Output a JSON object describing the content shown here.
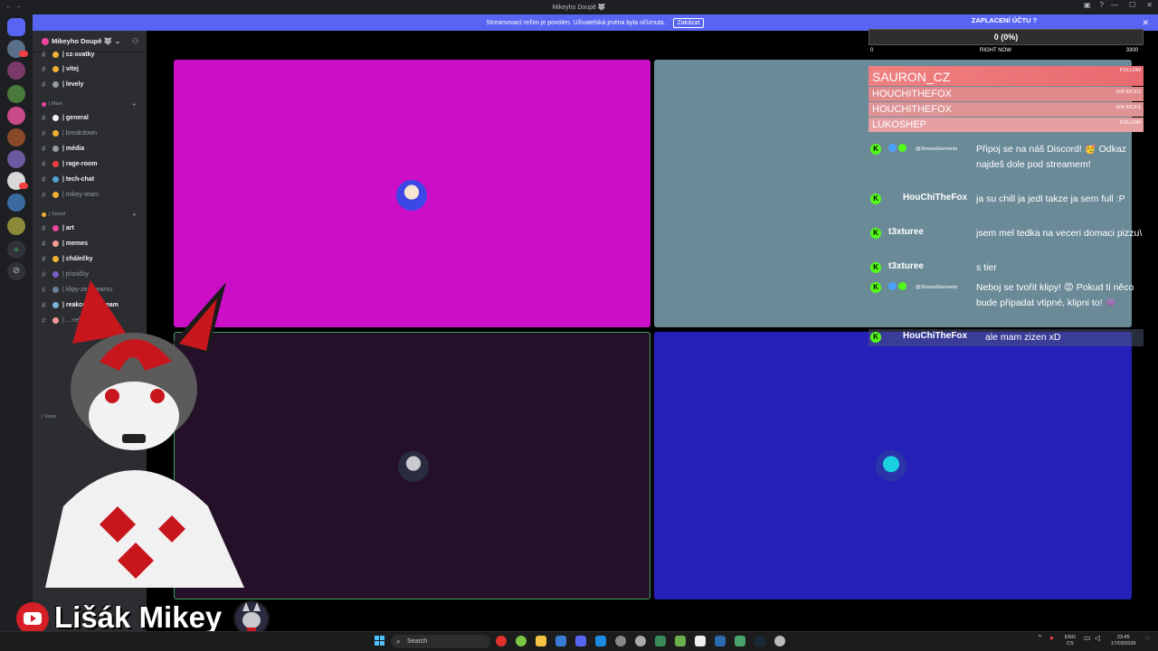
{
  "window": {
    "title": "Mikeyho Doupě 🐺",
    "nav_arrows": "← →",
    "controls": [
      "—",
      "☐",
      "✕"
    ]
  },
  "banner": {
    "text": "Streamovací režim je povolen. Uživatelská jména byla očíznuta.",
    "button": "Zakázat",
    "close": "✕"
  },
  "server": {
    "name": "Mikeyho Doupě 🐺",
    "chevron": "⌄"
  },
  "channels": {
    "top": [
      {
        "label": "| cz-svatky",
        "unread": true,
        "color": "#f0b232"
      },
      {
        "label": "| vitej",
        "unread": true,
        "color": "#f0b232"
      },
      {
        "label": "| levely",
        "unread": true,
        "color": "#949ba4"
      }
    ],
    "main_category": "| Main",
    "main": [
      {
        "label": "| general",
        "unread": true,
        "color": "#f2f3f5"
      },
      {
        "label": "| breakdown",
        "unread": false,
        "color": "#f0b232"
      },
      {
        "label": "| média",
        "unread": true,
        "color": "#949ba4"
      },
      {
        "label": "| rage-room",
        "unread": true,
        "color": "#f23f43"
      },
      {
        "label": "| tech-chat",
        "unread": true,
        "color": "#4fa3d1"
      },
      {
        "label": "| mikey-team",
        "unread": false,
        "color": "#f0b232"
      }
    ],
    "social_category": "| Social",
    "social": [
      {
        "label": "| art",
        "unread": true,
        "color": "#eb459e"
      },
      {
        "label": "| memes",
        "unread": true,
        "color": "#f29a99"
      },
      {
        "label": "| chálečky",
        "unread": true,
        "color": "#f0b232"
      },
      {
        "label": "| písničky",
        "unread": false,
        "color": "#7a5ec8"
      },
      {
        "label": "| klipy-ze-streamu",
        "unread": false,
        "color": "#6a7f9a"
      },
      {
        "label": "| reakce-na-stream",
        "unread": true,
        "color": "#7cb3d8"
      },
      {
        "label": "| ...-related",
        "unread": false,
        "color": "#f29a99"
      }
    ],
    "voice_category": "| Voice"
  },
  "overlay": {
    "payment_title": "ZAPLACENÍ ÚČTU ?",
    "payment_value": "0 (0%)",
    "scale_min": "0",
    "scale_label": "RIGHT NOW",
    "scale_max": "3300",
    "alerts": [
      {
        "name": "SAURON_CZ",
        "tag": "FOLLOW"
      },
      {
        "name": "HOUCHITHEFOX",
        "tag": "500 KICKS"
      },
      {
        "name": "HOUCHITHEFOX",
        "tag": "500 KICKS"
      },
      {
        "name": "LUKOSHEP",
        "tag": "FOLLOW"
      }
    ]
  },
  "chat": [
    {
      "user": "@StreamElements",
      "small": true,
      "text": "Připoj se na náš Discord! 🥳 Odkaz najdeš dole pod streamem!"
    },
    {
      "user": "HouChiTheFox",
      "small": false,
      "text": "ja su chill ja jedl takze ja sem full :P"
    },
    {
      "user": "t3xturee",
      "small": false,
      "text": "jsem mel tedka na veceri domaci pizzu\\"
    },
    {
      "user": "t3xturee",
      "small": false,
      "text": "s tier"
    },
    {
      "user": "@StreamElements",
      "small": true,
      "text": "Neboj se tvořit klipy! 😡 Pokud ti něco bude připadat vtipné, klipni to! 👾"
    },
    {
      "user": "HouChiTheFox",
      "small": false,
      "text": "ale mam zizen xD"
    }
  ],
  "streamer": {
    "name": "Lišák Mikey"
  },
  "taskbar": {
    "search": "Search",
    "lang_top": "ENG",
    "lang_bottom": "CS",
    "time": "23:45",
    "date": "17/03/2026"
  },
  "colors": {
    "tile1": "#cc0fc7",
    "tile2": "#6b8a98",
    "tile3": "#251029",
    "tile4": "#2520b7",
    "kick_green": "#53fc18",
    "alert_pink": "#e8797d",
    "banner": "#5865f2"
  }
}
